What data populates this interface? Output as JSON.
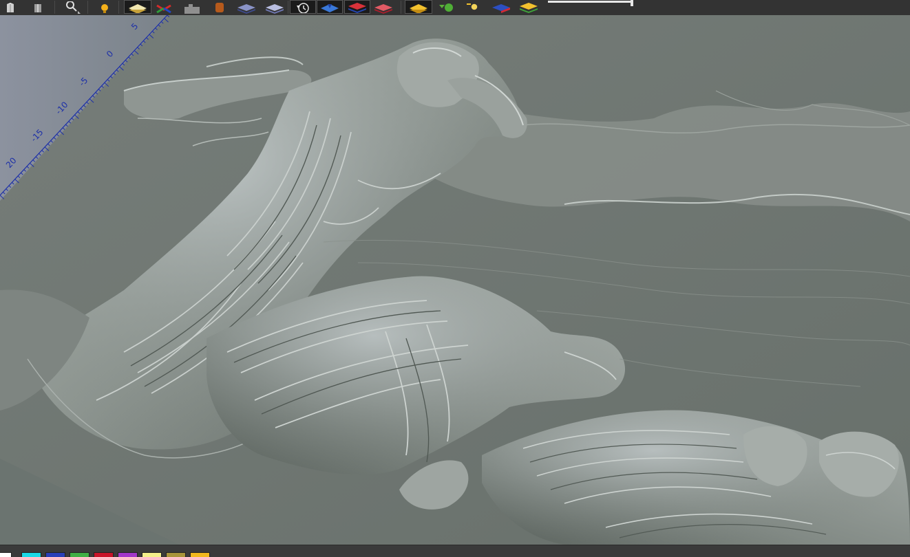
{
  "toolbar": {
    "buttons": [
      {
        "name": "view-iso-left-icon"
      },
      {
        "name": "view-iso-right-icon"
      },
      {
        "name": "zoom-icon"
      },
      {
        "name": "light-bulb-icon"
      },
      {
        "name": "layer-yellow-icon"
      },
      {
        "name": "vector-tool-icon"
      },
      {
        "name": "relief-shape-icon"
      },
      {
        "name": "cylinder-icon"
      },
      {
        "name": "layer-blue-dark-icon"
      },
      {
        "name": "layer-lavender-icon"
      },
      {
        "name": "timer-reset-icon"
      },
      {
        "name": "layer-blue-drop-icon"
      },
      {
        "name": "layer-red-blue-icon"
      },
      {
        "name": "layer-red-icon"
      },
      {
        "name": "layer-yellow-active-icon"
      },
      {
        "name": "green-dot-icon"
      },
      {
        "name": "search-layer-icon"
      },
      {
        "name": "layer-blue-red-icon"
      },
      {
        "name": "layer-green-yellow-icon"
      }
    ],
    "slider_value": 1.0
  },
  "viewport": {
    "ruler_labels": [
      "5",
      "0",
      "-5",
      "-10",
      "-15",
      "20"
    ]
  },
  "palette": {
    "swatches": [
      {
        "name": "swatch-white",
        "color": "#ffffff"
      },
      {
        "name": "swatch-cyan",
        "color": "#1ad9e6"
      },
      {
        "name": "swatch-blue",
        "color": "#2a3fb8"
      },
      {
        "name": "swatch-green",
        "color": "#3fae44"
      },
      {
        "name": "swatch-red",
        "color": "#c8142a"
      },
      {
        "name": "swatch-purple",
        "color": "#a236c8"
      },
      {
        "name": "swatch-light-yellow",
        "color": "#f4f08a"
      },
      {
        "name": "swatch-olive",
        "color": "#a8943a"
      },
      {
        "name": "swatch-amber",
        "color": "#f1b81e"
      }
    ]
  }
}
